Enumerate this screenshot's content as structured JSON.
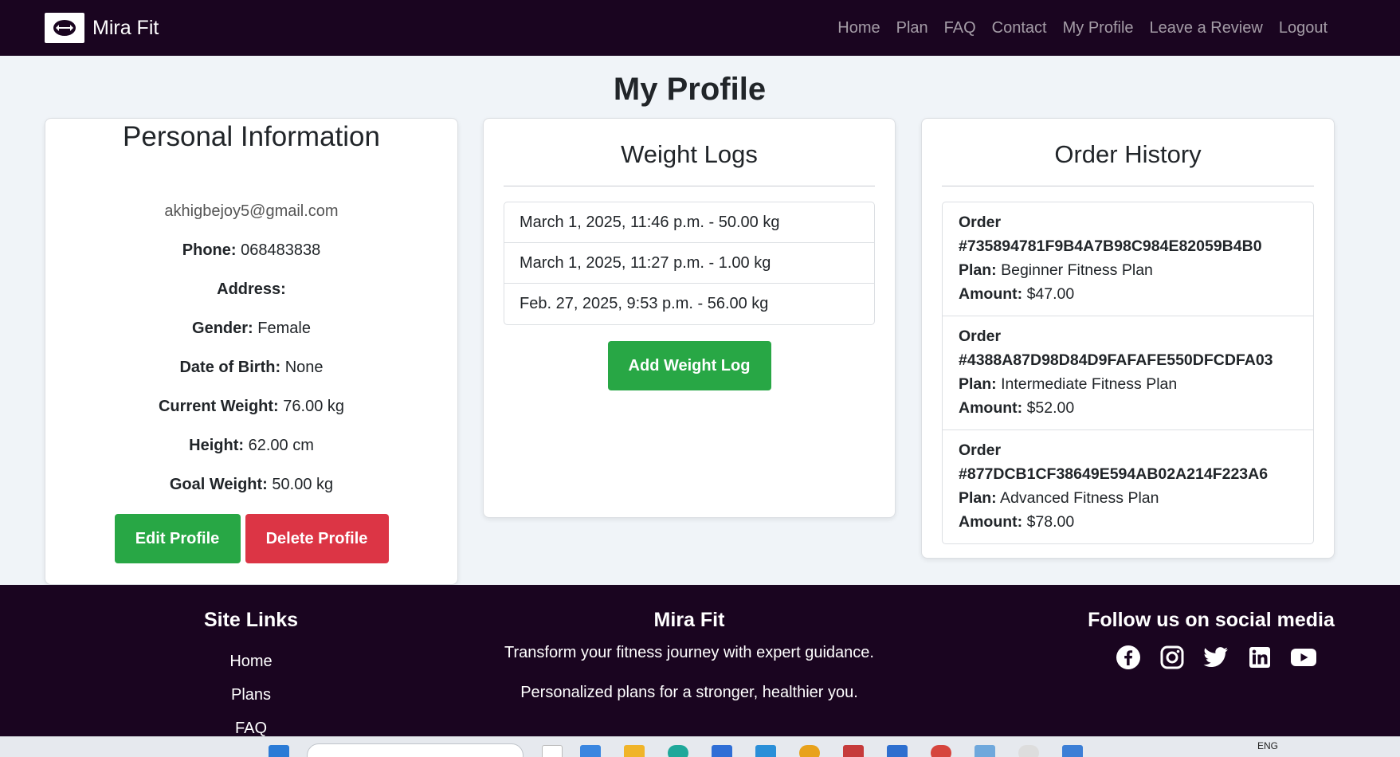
{
  "brand": {
    "name": "Mira Fit"
  },
  "nav": {
    "items": [
      "Home",
      "Plan",
      "FAQ",
      "Contact",
      "My Profile",
      "Leave a Review",
      "Logout"
    ]
  },
  "page_title": "My Profile",
  "personal": {
    "title": "Personal Information",
    "email": "akhigbejoy5@gmail.com",
    "fields": [
      {
        "label": "Phone:",
        "value": "068483838"
      },
      {
        "label": "Address:",
        "value": ""
      },
      {
        "label": "Gender:",
        "value": "Female"
      },
      {
        "label": "Date of Birth:",
        "value": "None"
      },
      {
        "label": "Current Weight:",
        "value": "76.00 kg"
      },
      {
        "label": "Height:",
        "value": "62.00 cm"
      },
      {
        "label": "Goal Weight:",
        "value": "50.00 kg"
      }
    ],
    "edit_label": "Edit Profile",
    "delete_label": "Delete Profile"
  },
  "weight_logs": {
    "title": "Weight Logs",
    "entries": [
      "March 1, 2025, 11:46 p.m. - 50.00 kg",
      "March 1, 2025, 11:27 p.m. - 1.00 kg",
      "Feb. 27, 2025, 9:53 p.m. - 56.00 kg"
    ],
    "add_label": "Add Weight Log"
  },
  "orders": {
    "title": "Order History",
    "order_label": "Order",
    "plan_label": "Plan:",
    "amount_label": "Amount:",
    "items": [
      {
        "id": "#735894781F9B4A7B98C984E82059B4B0",
        "plan": "Beginner Fitness Plan",
        "amount": "$47.00"
      },
      {
        "id": "#4388A87D98D84D9FAFAFE550DFCDFA03",
        "plan": "Intermediate Fitness Plan",
        "amount": "$52.00"
      },
      {
        "id": "#877DCB1CF38649E594AB02A214F223A6",
        "plan": "Advanced Fitness Plan",
        "amount": "$78.00"
      }
    ]
  },
  "footer": {
    "site_links_title": "Site Links",
    "site_links": [
      "Home",
      "Plans",
      "FAQ"
    ],
    "brand_title": "Mira Fit",
    "tagline1": "Transform your fitness journey with expert guidance.",
    "tagline2": "Personalized plans for a stronger, healthier you.",
    "social_title": "Follow us on social media",
    "social_icons": [
      "facebook-icon",
      "instagram-icon",
      "twitter-icon",
      "linkedin-icon",
      "youtube-icon"
    ]
  },
  "taskbar": {
    "lang": "ENG"
  },
  "colors": {
    "navbar_bg": "#1a0520",
    "success": "#28a745",
    "danger": "#dc3545",
    "page_bg": "#f0f4f8"
  }
}
